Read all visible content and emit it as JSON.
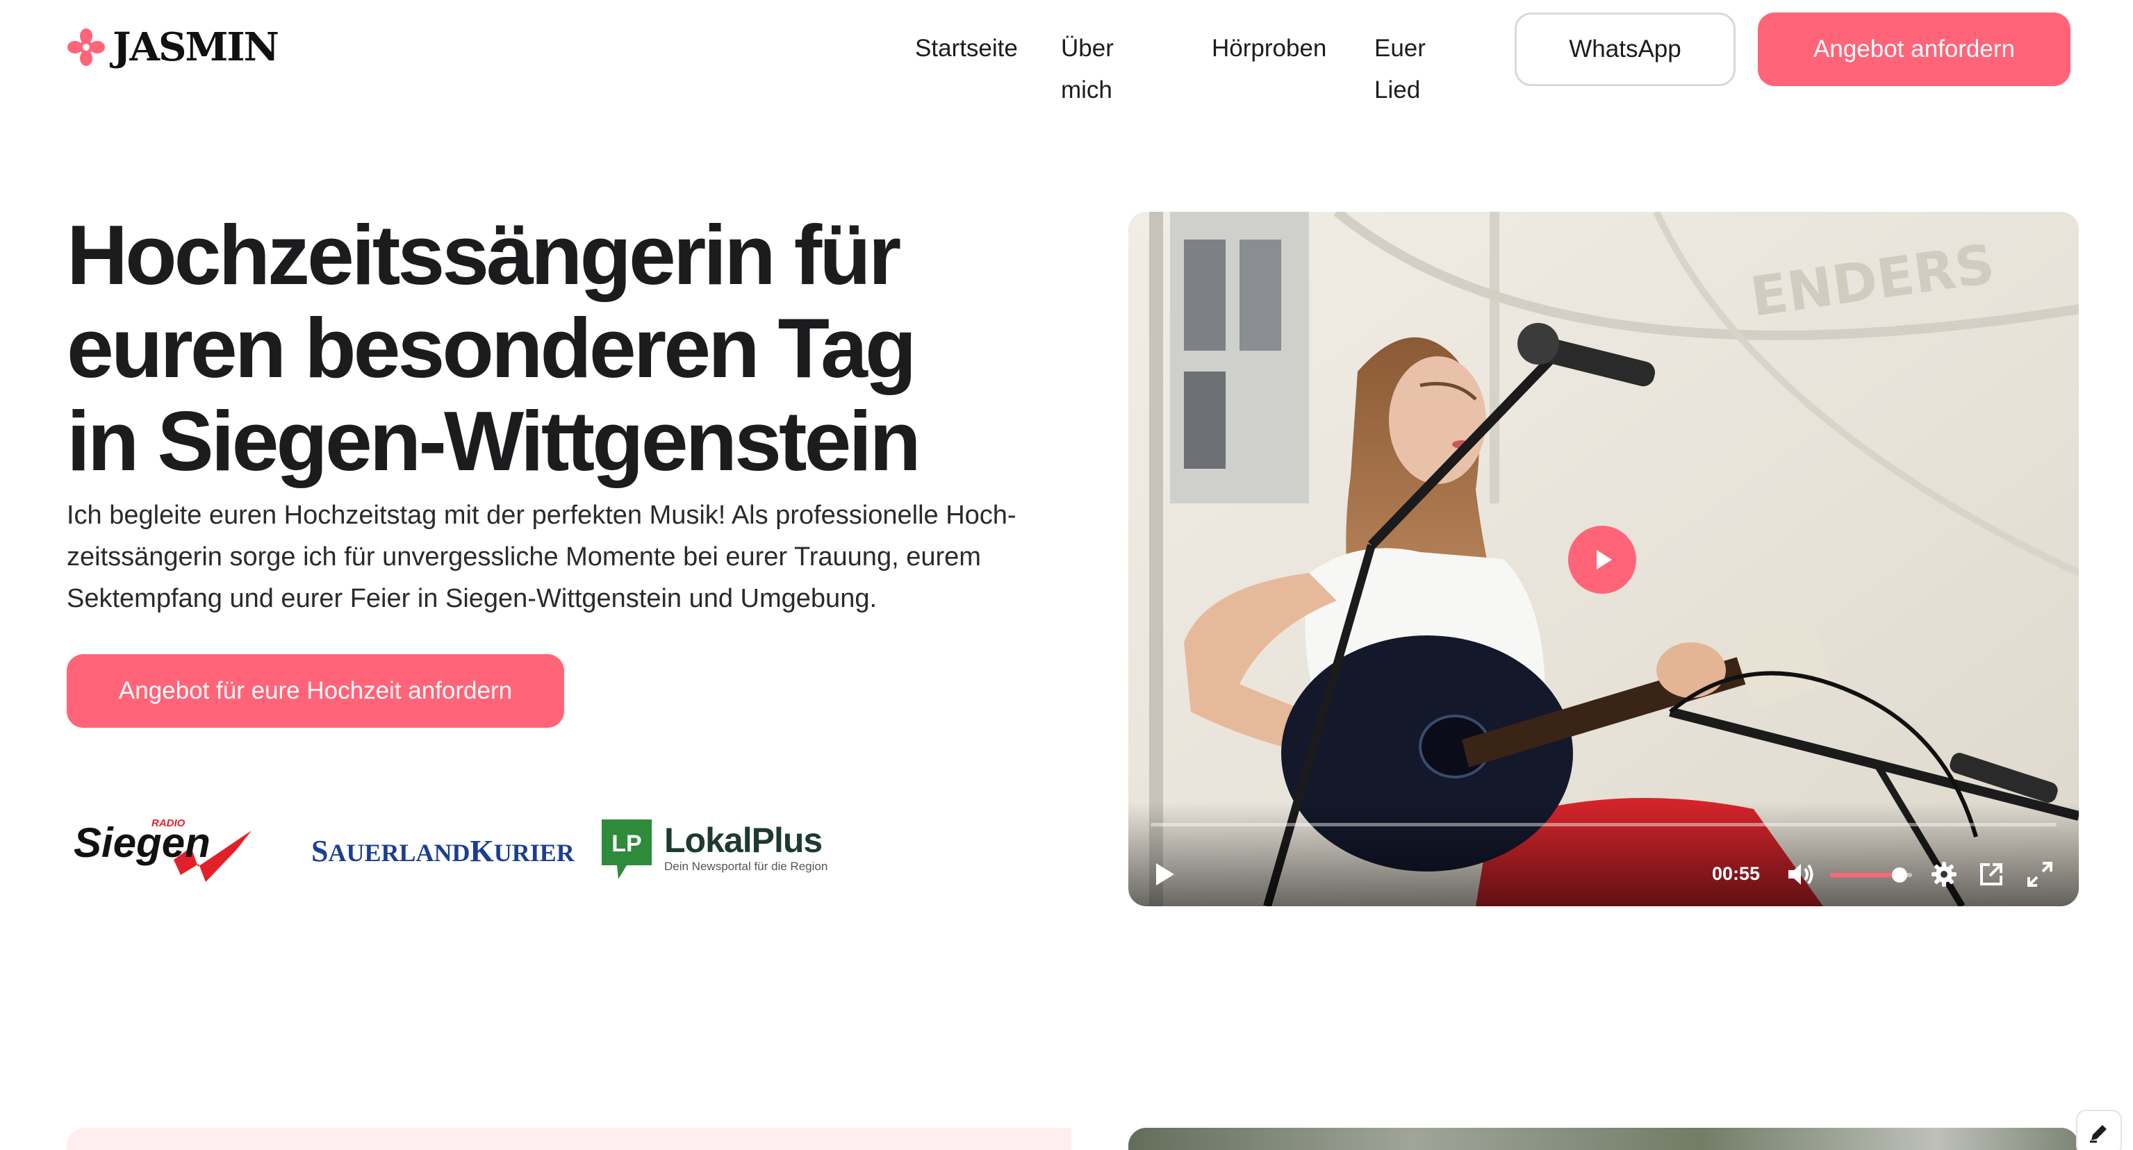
{
  "brand": {
    "name": "JASMIN",
    "accent": "#ff6479"
  },
  "nav": {
    "links": [
      "Startseite",
      "Über mich",
      "Hörproben",
      "Euer Lied"
    ],
    "whatsapp_label": "WhatsApp",
    "offer_label": "Angebot anfordern"
  },
  "hero": {
    "title_lines": [
      "Hochzeitssängerin für",
      "euren besonderen Tag",
      "in Siegen-Wittgenstein"
    ],
    "text_lines": [
      "Ich begleite euren Hochzeitstag mit der perfekten Musik! Als professionelle Hoch-",
      "zeitssängerin sorge ich für unvergessliche Momente bei eurer Trauung, eurem",
      "Sektempfang und eurer Feier in Siegen-Wittgenstein und Umgebung."
    ],
    "cta_label": "Angebot für eure Hochzeit anfordern"
  },
  "press": {
    "radio_siegen": {
      "top": "RADIO",
      "name": "Siegen"
    },
    "sauerland_kurier": {
      "part1": "S",
      "part1_small": "AUERLAND",
      "part2": "K",
      "part2_small": "URIER"
    },
    "lokalplus": {
      "badge": "LP",
      "name": "LokalPlus",
      "tagline": "Dein Newsportal für die Region"
    }
  },
  "video": {
    "time": "00:55",
    "progress": 0.0,
    "volume": 0.85,
    "banner_text": "ENDERS",
    "icons": [
      "play-icon",
      "volume-icon",
      "settings-icon",
      "pip-icon",
      "fullscreen-icon"
    ]
  }
}
